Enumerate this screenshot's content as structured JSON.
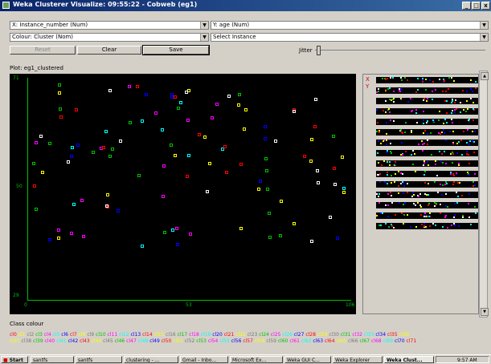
{
  "window": {
    "title": "Weka Clusterer Visualize: 09:55:22 - Cobweb (eg1)",
    "controls": [
      "_",
      "□",
      "x"
    ]
  },
  "controls": {
    "x_axis": "X: Instance_number (Num)",
    "y_axis": "Y: age (Num)",
    "colour": "Colour: Cluster (Nom)",
    "select": "Select Instance",
    "reset_label": "Reset",
    "clear_label": "Clear",
    "save_label": "Save",
    "jitter_label": "Jitter"
  },
  "plot": {
    "label": "Plot: eg1_clustered",
    "y_max": "71",
    "y_mid": "50",
    "y_min": "29",
    "x_min": "0",
    "x_mid": "53",
    "x_max": "106"
  },
  "side": {
    "x_marker": "X",
    "y_marker": "Y"
  },
  "legend": {
    "title": "Class colour",
    "row1": "cl0 cl1 cl2 cl3 cl4 cl5 cl6 cl7 cl8 cl9 cl10 cl11 cl12 cl13 cl14 cl15 cl16 cl17 cl18 cl19 cl20 cl21 cl22 cl23 cl24 cl25 cl26 cl27 cl28 cl29 cl30 cl31 cl32 cl33 cl34 cl35 cl36",
    "row2": "cl37 cl38 cl39 cl40 cl41 cl42 cl43 cl44 cl45 cl46 cl47 cl48 cl49 cl50 cl51 cl52 cl53 cl54 cl55 cl56 cl57 cl58 cl59 cl60 cl61 cl62 cl63 cl64 cl65 cl66 cl67 cl68 cl69 cl70 cl71"
  },
  "taskbar": {
    "start": "Start",
    "items": [
      "santfs",
      "santfs",
      "clustering - ...",
      "Gmail - Inbo...",
      "Microsoft Ex...",
      "Weka GUI C...",
      "Weka Explorer",
      "Weka Clust..."
    ],
    "clock": "9:57 AM"
  },
  "colors": {
    "green": "#00c000",
    "red": "#ff0000",
    "yellow": "#ffff00",
    "white": "#ffffff",
    "magenta": "#ff00ff",
    "cyan": "#00ffff",
    "blue": "#0000ff"
  }
}
